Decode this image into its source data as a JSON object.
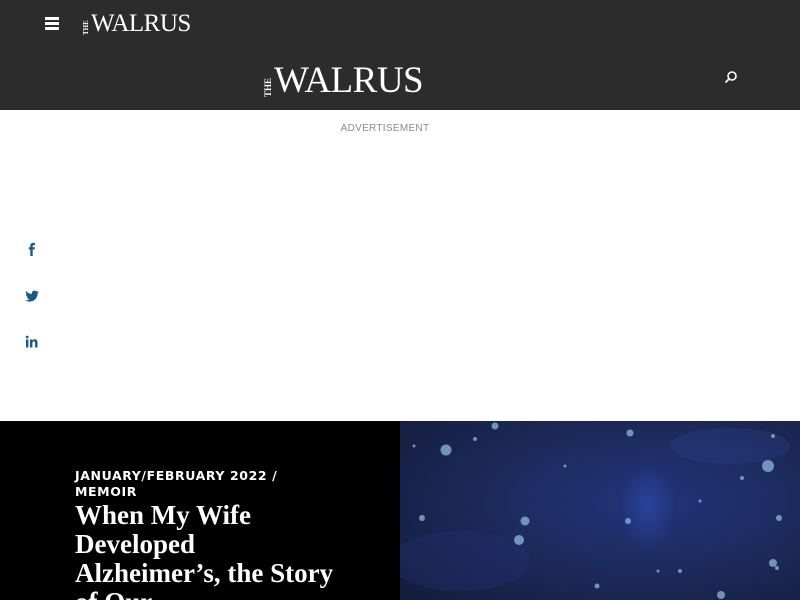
{
  "topbar": {
    "logo_the": "THE",
    "logo_name": "WALRUS",
    "menu_icon": "hamburger-menu-icon"
  },
  "header": {
    "logo_the": "THE",
    "logo_name": "WALRUS",
    "search_icon": "search-icon"
  },
  "ad": {
    "label": "ADVERTISEMENT"
  },
  "share": {
    "icons": [
      "facebook-icon",
      "twitter-icon",
      "linkedin-icon"
    ],
    "color": "#1a5a8a"
  },
  "article": {
    "issue": "JANUARY/FEBRUARY 2022",
    "separator": " / ",
    "section": "MEMOIR",
    "headline": "When My Wife Developed Alzheimer’s, the Story of Our"
  },
  "colors": {
    "bar_bg": "#2c2c2c",
    "hero_left_bg": "#000000",
    "hero_image_bg": "#1e2a4c"
  }
}
